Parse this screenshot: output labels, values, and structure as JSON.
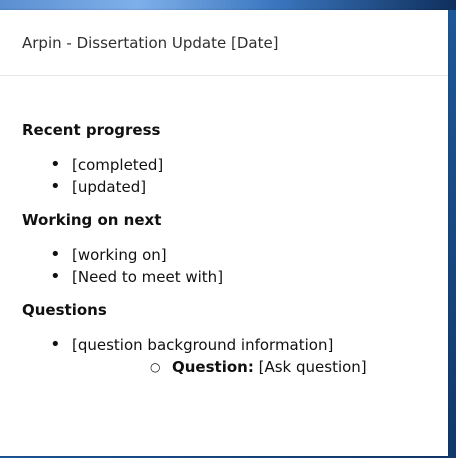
{
  "window": {
    "title": "Arpin - Dissertation Update [Date]"
  },
  "sections": [
    {
      "title": "Recent progress",
      "items": [
        "[completed]",
        "[updated]"
      ]
    },
    {
      "title": "Working on next",
      "items": [
        "[working on]",
        "[Need to meet with]"
      ]
    },
    {
      "title": "Questions",
      "items": [
        "[question background information]"
      ],
      "subitems": [
        {
          "label": "Question:",
          "text": "[Ask question]"
        }
      ]
    }
  ],
  "colors": {
    "background_blue": "#1f5fa3",
    "panel": "#ffffff",
    "text": "#111111"
  }
}
